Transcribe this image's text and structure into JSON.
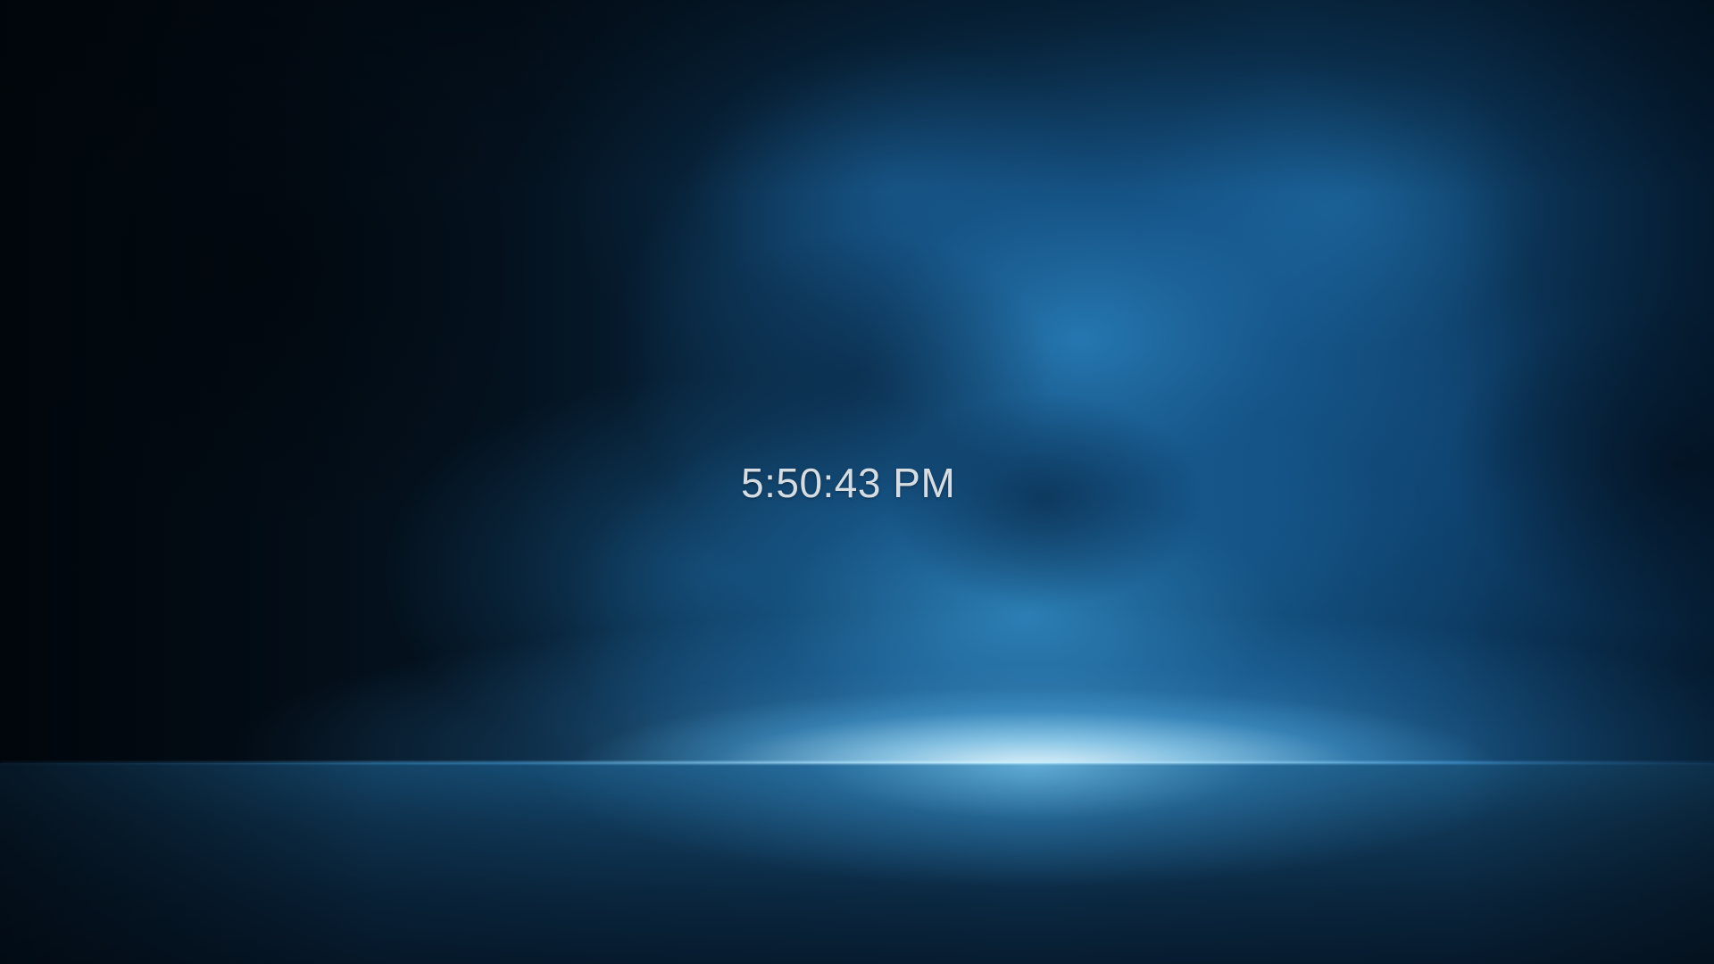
{
  "desktop": {
    "wallpaper_icon": "blue-smoke-stage-wallpaper",
    "accent_color": "#2f8fd0",
    "clock": {
      "time": "5:50:43 PM",
      "text_color": "#d6dde2"
    }
  }
}
